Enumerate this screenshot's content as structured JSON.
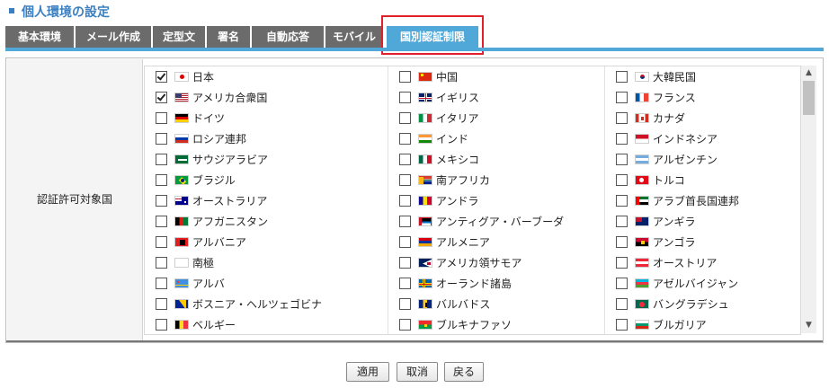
{
  "header": {
    "title": "個人環境の設定"
  },
  "tabs": [
    {
      "label": "基本環境",
      "active": false
    },
    {
      "label": "メール作成",
      "active": false
    },
    {
      "label": "定型文",
      "active": false
    },
    {
      "label": "署名",
      "active": false
    },
    {
      "label": "自動応答",
      "active": false
    },
    {
      "label": "モバイル",
      "active": false
    },
    {
      "label": "国別認証制限",
      "active": true
    }
  ],
  "section": {
    "label": "認証許可対象国"
  },
  "countries": [
    {
      "name": "日本",
      "checked": true,
      "flag": "jp"
    },
    {
      "name": "中国",
      "checked": false,
      "flag": "cn"
    },
    {
      "name": "大韓民国",
      "checked": false,
      "flag": "kr"
    },
    {
      "name": "アメリカ合衆国",
      "checked": true,
      "flag": "us"
    },
    {
      "name": "イギリス",
      "checked": false,
      "flag": "gb"
    },
    {
      "name": "フランス",
      "checked": false,
      "flag": "fr"
    },
    {
      "name": "ドイツ",
      "checked": false,
      "flag": "de"
    },
    {
      "name": "イタリア",
      "checked": false,
      "flag": "it"
    },
    {
      "name": "カナダ",
      "checked": false,
      "flag": "ca"
    },
    {
      "name": "ロシア連邦",
      "checked": false,
      "flag": "ru"
    },
    {
      "name": "インド",
      "checked": false,
      "flag": "in"
    },
    {
      "name": "インドネシア",
      "checked": false,
      "flag": "id"
    },
    {
      "name": "サウジアラビア",
      "checked": false,
      "flag": "sa"
    },
    {
      "name": "メキシコ",
      "checked": false,
      "flag": "mx"
    },
    {
      "name": "アルゼンチン",
      "checked": false,
      "flag": "ar"
    },
    {
      "name": "ブラジル",
      "checked": false,
      "flag": "br"
    },
    {
      "name": "南アフリカ",
      "checked": false,
      "flag": "za"
    },
    {
      "name": "トルコ",
      "checked": false,
      "flag": "tr"
    },
    {
      "name": "オーストラリア",
      "checked": false,
      "flag": "au"
    },
    {
      "name": "アンドラ",
      "checked": false,
      "flag": "ad"
    },
    {
      "name": "アラブ首長国連邦",
      "checked": false,
      "flag": "ae"
    },
    {
      "name": "アフガニスタン",
      "checked": false,
      "flag": "af"
    },
    {
      "name": "アンティグア・バーブーダ",
      "checked": false,
      "flag": "ag"
    },
    {
      "name": "アンギラ",
      "checked": false,
      "flag": "ai"
    },
    {
      "name": "アルバニア",
      "checked": false,
      "flag": "al"
    },
    {
      "name": "アルメニア",
      "checked": false,
      "flag": "am"
    },
    {
      "name": "アンゴラ",
      "checked": false,
      "flag": "ao"
    },
    {
      "name": "南極",
      "checked": false,
      "flag": "aq"
    },
    {
      "name": "アメリカ領サモア",
      "checked": false,
      "flag": "as"
    },
    {
      "name": "オーストリア",
      "checked": false,
      "flag": "at"
    },
    {
      "name": "アルバ",
      "checked": false,
      "flag": "aw"
    },
    {
      "name": "オーランド諸島",
      "checked": false,
      "flag": "ax"
    },
    {
      "name": "アゼルバイジャン",
      "checked": false,
      "flag": "az"
    },
    {
      "name": "ボスニア・ヘルツェゴビナ",
      "checked": false,
      "flag": "ba"
    },
    {
      "name": "バルバドス",
      "checked": false,
      "flag": "bb"
    },
    {
      "name": "バングラデシュ",
      "checked": false,
      "flag": "bd"
    },
    {
      "name": "ベルギー",
      "checked": false,
      "flag": "be"
    },
    {
      "name": "ブルキナファソ",
      "checked": false,
      "flag": "bf"
    },
    {
      "name": "ブルガリア",
      "checked": false,
      "flag": "bg"
    }
  ],
  "buttons": {
    "apply": "適用",
    "cancel": "取消",
    "back": "戻る"
  }
}
